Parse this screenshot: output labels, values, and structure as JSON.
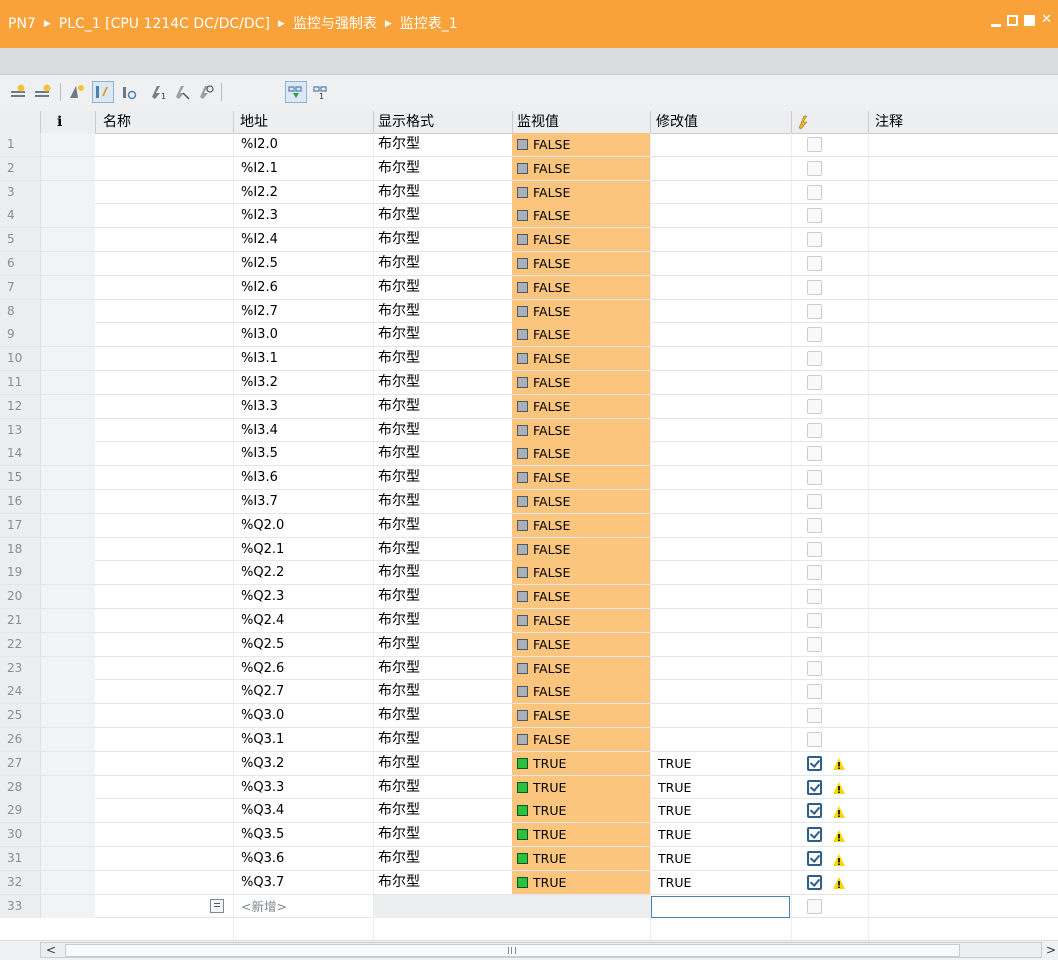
{
  "titlebar": {
    "crumbs": [
      "PN7",
      "PLC_1 [CPU 1214C DC/DC/DC]",
      "监控与强制表",
      "监控表_1"
    ],
    "window_controls": [
      "minimize-icon",
      "float-icon",
      "maximize-icon",
      "close-icon"
    ]
  },
  "toolbar": {
    "buttons": [
      "insert-row-icon",
      "add-row-icon",
      "update-all-icon",
      "monitor-once-icon",
      "scan-mode-icon",
      "force-icon",
      "unforce-icon",
      "force-all-icon",
      "monitor-all-icon",
      "monitor-now-icon"
    ]
  },
  "columns": {
    "num": "",
    "info": "i",
    "name": "名称",
    "address": "地址",
    "format": "显示格式",
    "monitor": "监视值",
    "modify": "修改值",
    "force": "force-column-icon",
    "comment": "注释"
  },
  "rows": [
    {
      "n": "1",
      "addr": "%I2.0",
      "fmt": "布尔型",
      "mon": "FALSE",
      "mod": "",
      "force": false
    },
    {
      "n": "2",
      "addr": "%I2.1",
      "fmt": "布尔型",
      "mon": "FALSE",
      "mod": "",
      "force": false
    },
    {
      "n": "3",
      "addr": "%I2.2",
      "fmt": "布尔型",
      "mon": "FALSE",
      "mod": "",
      "force": false
    },
    {
      "n": "4",
      "addr": "%I2.3",
      "fmt": "布尔型",
      "mon": "FALSE",
      "mod": "",
      "force": false
    },
    {
      "n": "5",
      "addr": "%I2.4",
      "fmt": "布尔型",
      "mon": "FALSE",
      "mod": "",
      "force": false
    },
    {
      "n": "6",
      "addr": "%I2.5",
      "fmt": "布尔型",
      "mon": "FALSE",
      "mod": "",
      "force": false
    },
    {
      "n": "7",
      "addr": "%I2.6",
      "fmt": "布尔型",
      "mon": "FALSE",
      "mod": "",
      "force": false
    },
    {
      "n": "8",
      "addr": "%I2.7",
      "fmt": "布尔型",
      "mon": "FALSE",
      "mod": "",
      "force": false
    },
    {
      "n": "9",
      "addr": "%I3.0",
      "fmt": "布尔型",
      "mon": "FALSE",
      "mod": "",
      "force": false
    },
    {
      "n": "10",
      "addr": "%I3.1",
      "fmt": "布尔型",
      "mon": "FALSE",
      "mod": "",
      "force": false
    },
    {
      "n": "11",
      "addr": "%I3.2",
      "fmt": "布尔型",
      "mon": "FALSE",
      "mod": "",
      "force": false
    },
    {
      "n": "12",
      "addr": "%I3.3",
      "fmt": "布尔型",
      "mon": "FALSE",
      "mod": "",
      "force": false
    },
    {
      "n": "13",
      "addr": "%I3.4",
      "fmt": "布尔型",
      "mon": "FALSE",
      "mod": "",
      "force": false
    },
    {
      "n": "14",
      "addr": "%I3.5",
      "fmt": "布尔型",
      "mon": "FALSE",
      "mod": "",
      "force": false
    },
    {
      "n": "15",
      "addr": "%I3.6",
      "fmt": "布尔型",
      "mon": "FALSE",
      "mod": "",
      "force": false
    },
    {
      "n": "16",
      "addr": "%I3.7",
      "fmt": "布尔型",
      "mon": "FALSE",
      "mod": "",
      "force": false
    },
    {
      "n": "17",
      "addr": "%Q2.0",
      "fmt": "布尔型",
      "mon": "FALSE",
      "mod": "",
      "force": false
    },
    {
      "n": "18",
      "addr": "%Q2.1",
      "fmt": "布尔型",
      "mon": "FALSE",
      "mod": "",
      "force": false
    },
    {
      "n": "19",
      "addr": "%Q2.2",
      "fmt": "布尔型",
      "mon": "FALSE",
      "mod": "",
      "force": false
    },
    {
      "n": "20",
      "addr": "%Q2.3",
      "fmt": "布尔型",
      "mon": "FALSE",
      "mod": "",
      "force": false
    },
    {
      "n": "21",
      "addr": "%Q2.4",
      "fmt": "布尔型",
      "mon": "FALSE",
      "mod": "",
      "force": false
    },
    {
      "n": "22",
      "addr": "%Q2.5",
      "fmt": "布尔型",
      "mon": "FALSE",
      "mod": "",
      "force": false
    },
    {
      "n": "23",
      "addr": "%Q2.6",
      "fmt": "布尔型",
      "mon": "FALSE",
      "mod": "",
      "force": false
    },
    {
      "n": "24",
      "addr": "%Q2.7",
      "fmt": "布尔型",
      "mon": "FALSE",
      "mod": "",
      "force": false
    },
    {
      "n": "25",
      "addr": "%Q3.0",
      "fmt": "布尔型",
      "mon": "FALSE",
      "mod": "",
      "force": false
    },
    {
      "n": "26",
      "addr": "%Q3.1",
      "fmt": "布尔型",
      "mon": "FALSE",
      "mod": "",
      "force": false
    },
    {
      "n": "27",
      "addr": "%Q3.2",
      "fmt": "布尔型",
      "mon": "TRUE",
      "mod": "TRUE",
      "force": true
    },
    {
      "n": "28",
      "addr": "%Q3.3",
      "fmt": "布尔型",
      "mon": "TRUE",
      "mod": "TRUE",
      "force": true
    },
    {
      "n": "29",
      "addr": "%Q3.4",
      "fmt": "布尔型",
      "mon": "TRUE",
      "mod": "TRUE",
      "force": true
    },
    {
      "n": "30",
      "addr": "%Q3.5",
      "fmt": "布尔型",
      "mon": "TRUE",
      "mod": "TRUE",
      "force": true
    },
    {
      "n": "31",
      "addr": "%Q3.6",
      "fmt": "布尔型",
      "mon": "TRUE",
      "mod": "TRUE",
      "force": true
    },
    {
      "n": "32",
      "addr": "%Q3.7",
      "fmt": "布尔型",
      "mon": "TRUE",
      "mod": "TRUE",
      "force": true
    }
  ],
  "new_row": {
    "n": "33",
    "label": "<新增>"
  },
  "colors": {
    "title_bar": "#f9a23a",
    "monitor_bg": "#fbc57d",
    "true_led": "#29c23f",
    "false_led": "#a9b0b8",
    "warning": "#f5d90a"
  }
}
